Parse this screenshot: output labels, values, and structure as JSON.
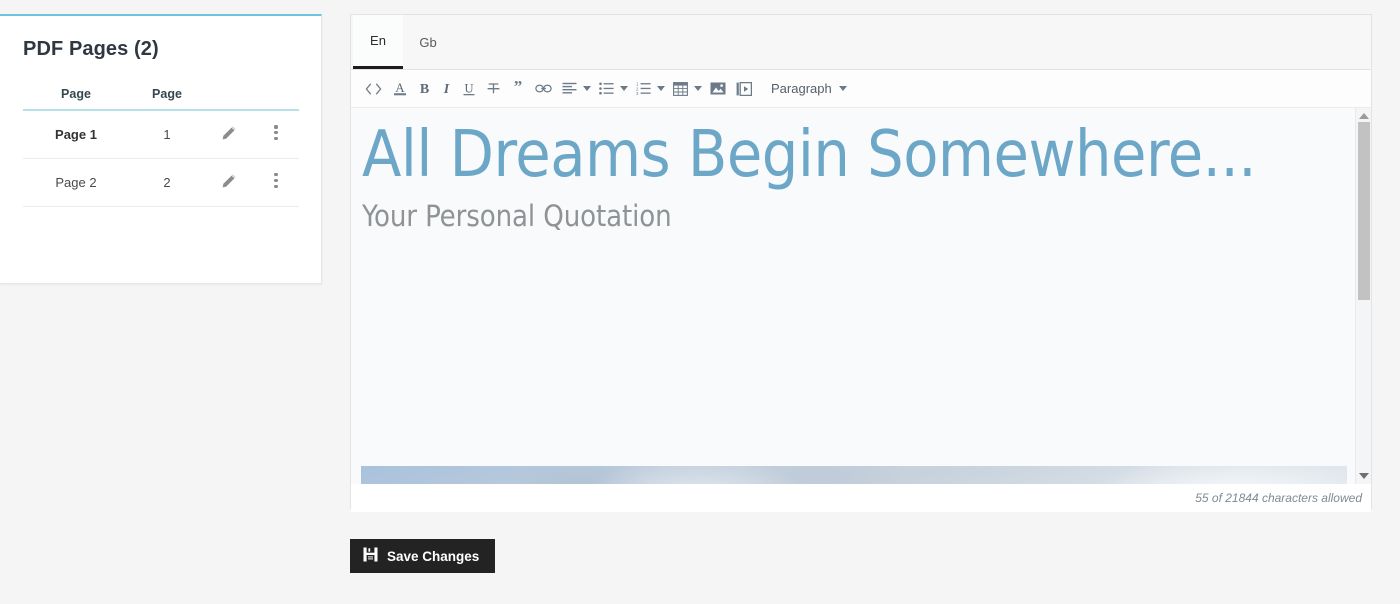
{
  "pages_card": {
    "title": "PDF Pages (2)",
    "columns": [
      "Page",
      "Page",
      "",
      ""
    ],
    "rows": [
      {
        "name": "Page 1",
        "number": "1",
        "edit_icon": "pencil-icon",
        "menu_icon": "kebab-menu-icon"
      },
      {
        "name": "Page 2",
        "number": "2",
        "edit_icon": "pencil-icon",
        "menu_icon": "kebab-menu-icon"
      }
    ],
    "accent_color": "#6ec4dd",
    "header_rule_color": "#b7e1e8"
  },
  "editor": {
    "tabs": [
      {
        "label": "En",
        "active": true
      },
      {
        "label": "Gb",
        "active": false
      }
    ],
    "toolbar": {
      "buttons": [
        {
          "name": "code-view-icon",
          "title": "Code View"
        },
        {
          "name": "font-color-icon",
          "title": "Font Color"
        },
        {
          "name": "bold-icon",
          "title": "Bold"
        },
        {
          "name": "italic-icon",
          "title": "Italic"
        },
        {
          "name": "underline-icon",
          "title": "Underline"
        },
        {
          "name": "strikethrough-icon",
          "title": "Strikethrough"
        },
        {
          "name": "blockquote-icon",
          "title": "Blockquote"
        },
        {
          "name": "link-icon",
          "title": "Insert Link"
        },
        {
          "name": "align-left-icon",
          "title": "Alignment"
        },
        {
          "name": "bullet-list-icon",
          "title": "Unordered List"
        },
        {
          "name": "numbered-list-icon",
          "title": "Ordered List"
        },
        {
          "name": "table-icon",
          "title": "Table"
        },
        {
          "name": "image-icon",
          "title": "Insert Image"
        },
        {
          "name": "video-icon",
          "title": "Insert Video"
        }
      ],
      "paragraph_label": "Paragraph"
    },
    "content": {
      "heading": "All Dreams Begin Somewhere...",
      "subheading": "Your Personal Quotation",
      "image_alt": "cloudy-sky-banner",
      "heading_color": "#6ca7c8",
      "subheading_color": "#8f9396"
    },
    "scrollbar": {
      "up_icon": "scroll-up-arrow-icon",
      "down_icon": "scroll-down-arrow-icon"
    },
    "character_count": "55 of 21844 characters allowed"
  },
  "footer": {
    "save_label": "Save Changes",
    "save_icon": "floppy-disk-icon",
    "save_bg": "#232323"
  }
}
